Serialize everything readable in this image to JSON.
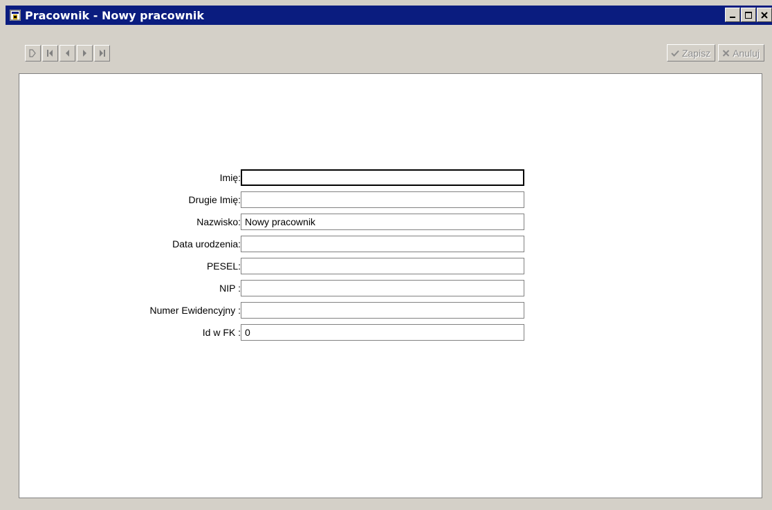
{
  "window": {
    "title": "Pracownik - Nowy pracownik"
  },
  "toolbar": {
    "nav_buttons": [
      {
        "icon": "new-record-icon"
      },
      {
        "icon": "first-record-icon"
      },
      {
        "icon": "previous-record-icon"
      },
      {
        "icon": "next-record-icon"
      },
      {
        "icon": "last-record-icon"
      }
    ],
    "save_label": "Zapisz",
    "cancel_label": "Anuluj"
  },
  "form": {
    "fields": [
      {
        "label": "Imię:",
        "value": ""
      },
      {
        "label": "Drugie Imię:",
        "value": ""
      },
      {
        "label": "Nazwisko:",
        "value": "Nowy pracownik"
      },
      {
        "label": "Data urodzenia:",
        "value": ""
      },
      {
        "label": "PESEL:",
        "value": ""
      },
      {
        "label": "NIP :",
        "value": ""
      },
      {
        "label": "Numer Ewidencyjny :",
        "value": ""
      },
      {
        "label": "Id w FK :",
        "value": "0"
      }
    ]
  },
  "colors": {
    "titlebar": "#0a1c7f",
    "face": "#d4d0c8",
    "disabled_text": "#8c8c8c"
  }
}
